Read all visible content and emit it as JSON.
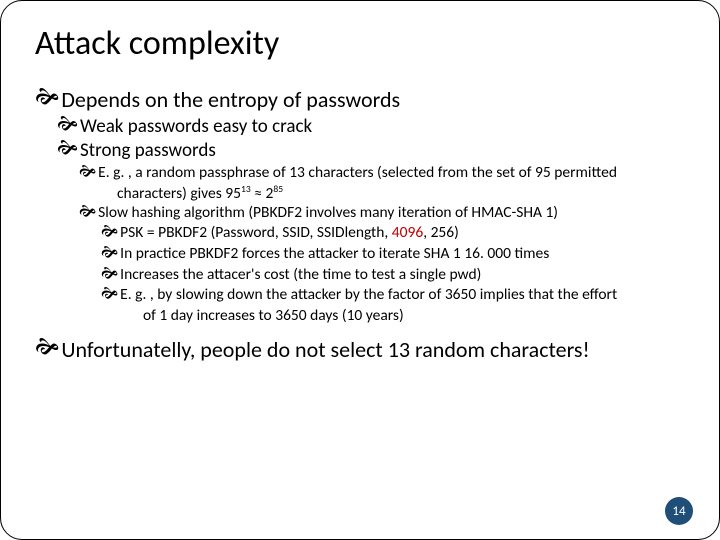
{
  "title": "Attack complexity",
  "l1": {
    "a": "Depends on the entropy of passwords",
    "b": "Unfortunatelly, people do not select 13 random characters!"
  },
  "l2": {
    "a": "Weak passwords easy to crack",
    "b": "Strong passwords"
  },
  "l3": {
    "a1": "E. g. , a random passphrase of 13 characters (selected from the set of 95 permitted",
    "a2_pre": "characters) gives 95",
    "a2_exp1": "13",
    "a2_mid": " ≈ 2",
    "a2_exp2": "85",
    "b": "Slow hashing algorithm (PBKDF2 involves many iteration of HMAC-SHA 1)"
  },
  "l4": {
    "a_pre": "PSK = PBKDF2 (Password, SSID, SSIDlength, ",
    "a_red": "4096",
    "a_post": ", 256)",
    "b": "In practice PBKDF2 forces the attacker to iterate SHA 1 16. 000 times",
    "c": "Increases the attacer's cost (the time to test a single pwd)",
    "d1": "E. g. , by slowing down the attacker by the factor of 3650 implies that the effort",
    "d2": "of 1 day increases to 3650 days (10 years)"
  },
  "page": "14"
}
